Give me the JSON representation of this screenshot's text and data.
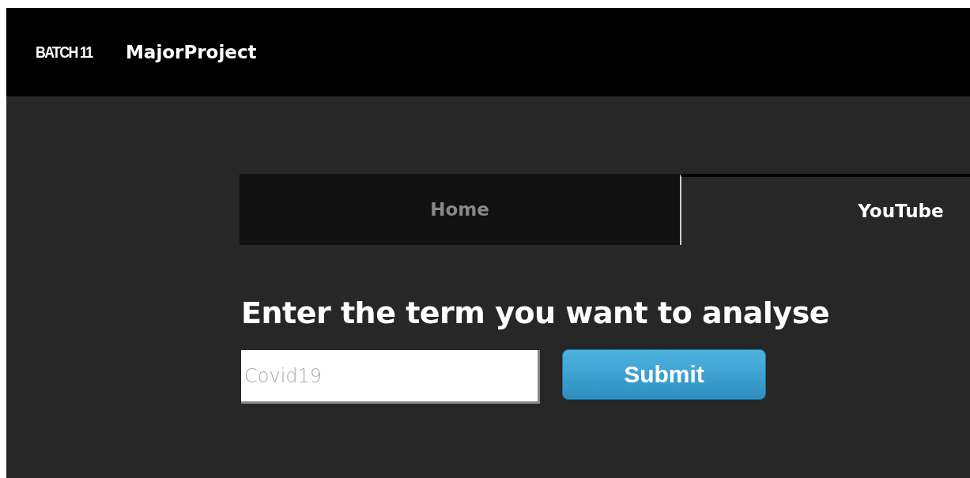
{
  "navbar": {
    "logo": "BATCH 11",
    "title": "MajorProject"
  },
  "tabs": [
    {
      "label": "Home",
      "selected": false
    },
    {
      "label": "YouTube",
      "selected": true
    }
  ],
  "heading": "Enter the term you want to analyse",
  "search": {
    "placeholder": "Covid19"
  },
  "submit": "Submit"
}
